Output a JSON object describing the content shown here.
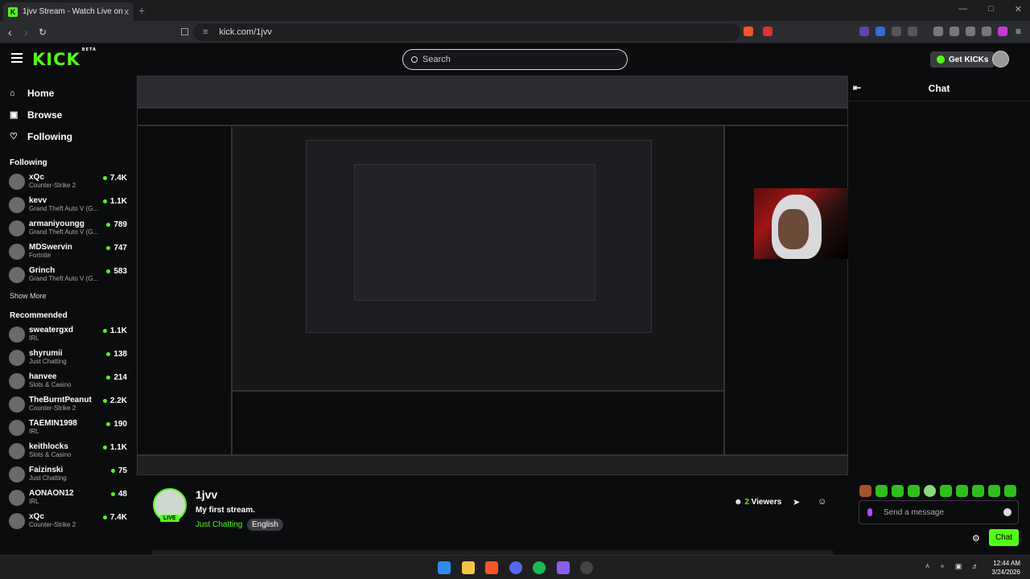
{
  "browser": {
    "tab_title": "1jvv Stream - Watch Live on Kick",
    "tab_favicon": "K",
    "url": "kick.com/1jvv",
    "new_tab": "+",
    "close_tab": "x"
  },
  "header": {
    "logo": "KICK",
    "logo_sup": "BETA",
    "search_placeholder": "Search",
    "get_kicks": "Get KICKs"
  },
  "sidebar": {
    "nav": [
      {
        "label": "Home",
        "icon": "home-icon"
      },
      {
        "label": "Browse",
        "icon": "compass-icon"
      },
      {
        "label": "Following",
        "icon": "heart-icon"
      }
    ],
    "following_title": "Following",
    "following": [
      {
        "name": "xQc",
        "category": "Counter-Strike 2",
        "viewers": "7.4K"
      },
      {
        "name": "kevv",
        "category": "Grand Theft Auto V (G...",
        "viewers": "1.1K"
      },
      {
        "name": "armaniyoungg",
        "category": "Grand Theft Auto V (G...",
        "viewers": "789"
      },
      {
        "name": "MDSwervin",
        "category": "Fortnite",
        "viewers": "747"
      },
      {
        "name": "Grinch",
        "category": "Grand Theft Auto V (G...",
        "viewers": "583"
      }
    ],
    "show_more": "Show More",
    "recommended_title": "Recommended",
    "recommended": [
      {
        "name": "sweatergxd",
        "category": "IRL",
        "viewers": "1.1K"
      },
      {
        "name": "shyrumii",
        "category": "Just Chatting",
        "viewers": "138"
      },
      {
        "name": "hanvee",
        "category": "Slots & Casino",
        "viewers": "214"
      },
      {
        "name": "TheBurntPeanut",
        "category": "Counter-Strike 2",
        "viewers": "2.2K"
      },
      {
        "name": "TAEMIN1998",
        "category": "IRL",
        "viewers": "190"
      },
      {
        "name": "keithlocks",
        "category": "Slots & Casino",
        "viewers": "1.1K"
      },
      {
        "name": "Faizinski",
        "category": "Just Chatting",
        "viewers": "75"
      },
      {
        "name": "AONAON12",
        "category": "IRL",
        "viewers": "48"
      },
      {
        "name": "xQc",
        "category": "Counter-Strike 2",
        "viewers": "7.4K"
      }
    ]
  },
  "stream": {
    "streamer": "1jvv",
    "title": "My first stream.",
    "category": "Just Chatting",
    "language": "English",
    "live": "LIVE",
    "viewer_count": "2",
    "viewers_label": "Viewers"
  },
  "chat": {
    "title": "Chat",
    "placeholder": "Send a message",
    "send": "Chat"
  },
  "taskbar": {
    "time": "12:44 AM",
    "date": "3/24/2026"
  },
  "colors": {
    "accent": "#53fc18",
    "background": "#0b0c0d"
  }
}
